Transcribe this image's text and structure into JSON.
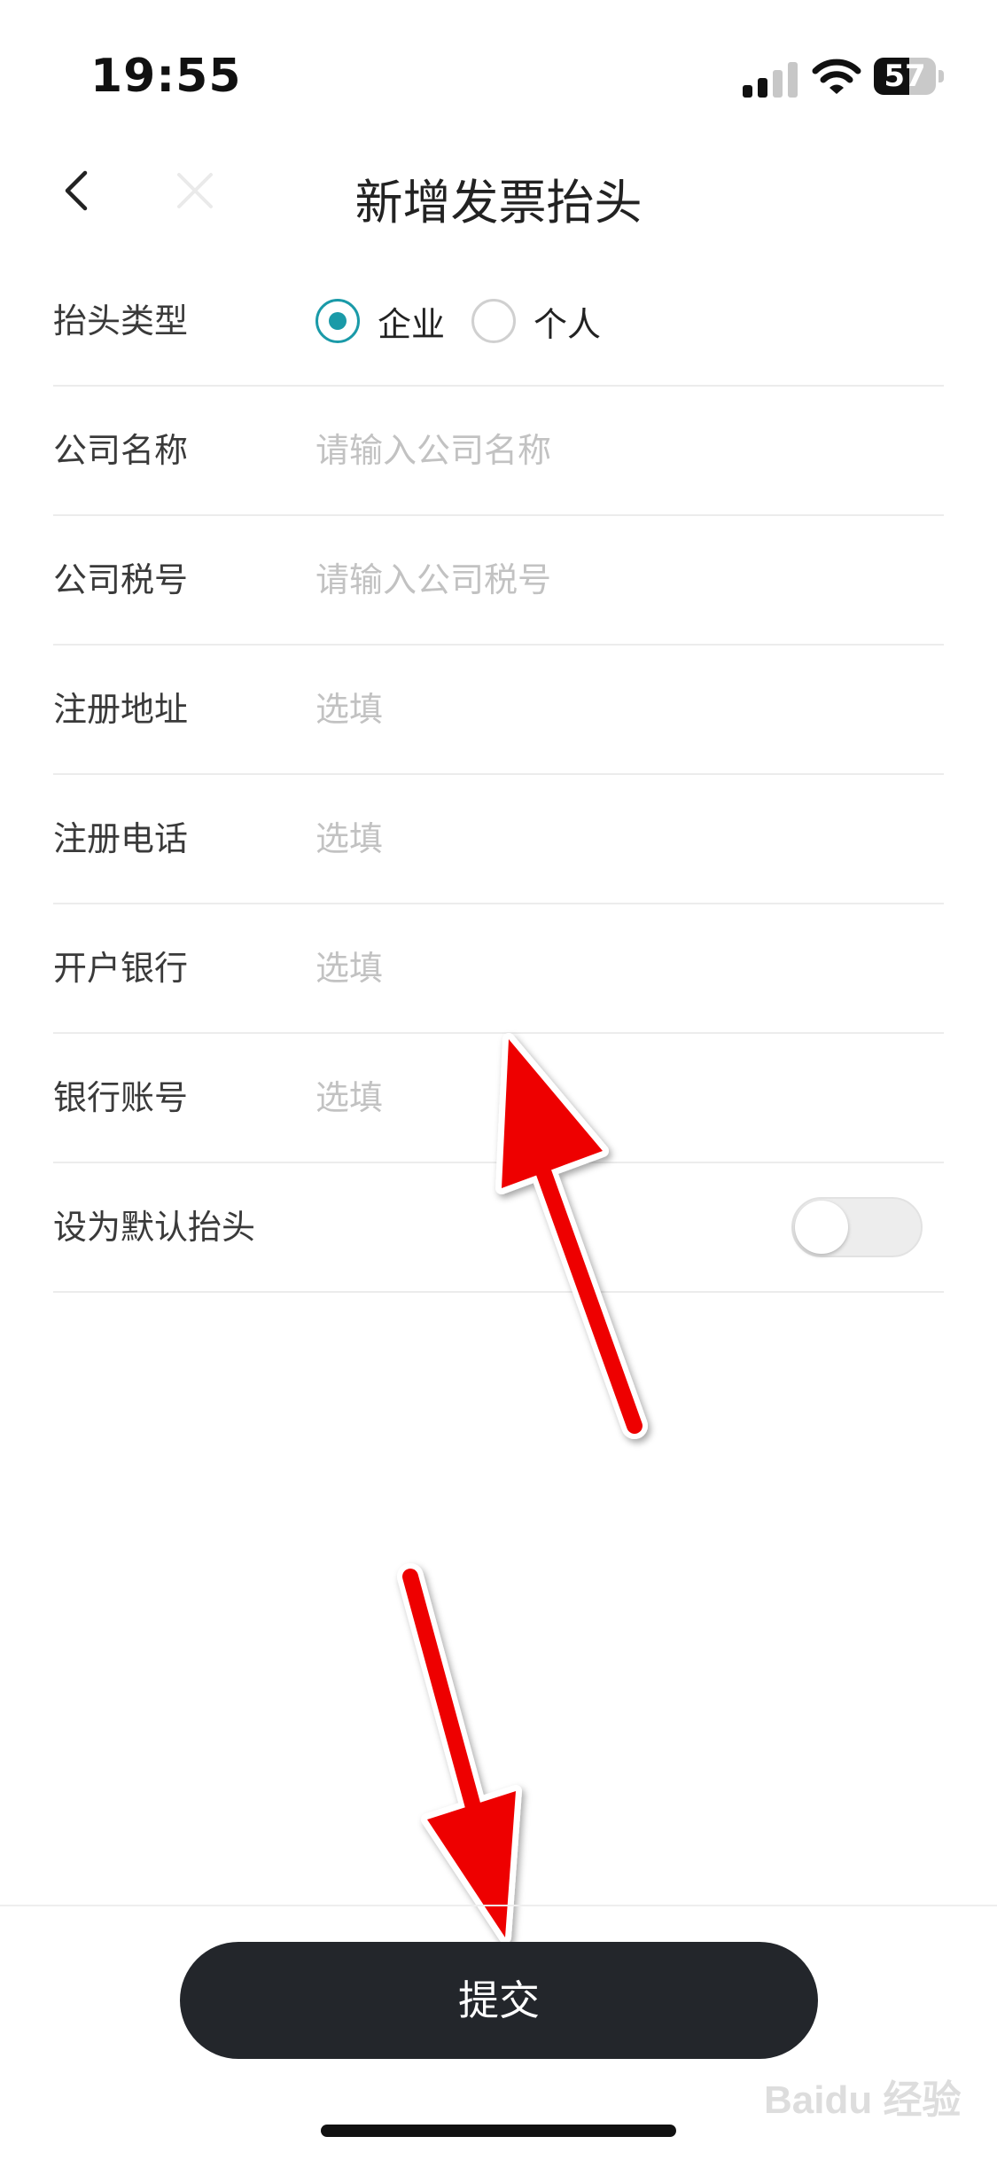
{
  "status_bar": {
    "time": "19:55",
    "battery": "57",
    "battery_level": 0.57
  },
  "nav": {
    "title": "新增发票抬头",
    "back_icon": "chevron-left-icon",
    "close_icon": "close-icon"
  },
  "form": {
    "header_type": {
      "label": "抬头类型",
      "options": [
        "企业",
        "个人"
      ],
      "selected": "企业"
    },
    "fields": [
      {
        "label": "公司名称",
        "placeholder": "请输入公司名称",
        "value": ""
      },
      {
        "label": "公司税号",
        "placeholder": "请输入公司税号",
        "value": ""
      },
      {
        "label": "注册地址",
        "placeholder": "选填",
        "value": ""
      },
      {
        "label": "注册电话",
        "placeholder": "选填",
        "value": ""
      },
      {
        "label": "开户银行",
        "placeholder": "选填",
        "value": ""
      },
      {
        "label": "银行账号",
        "placeholder": "选填",
        "value": ""
      }
    ],
    "default_toggle": {
      "label": "设为默认抬头",
      "on": false
    }
  },
  "submit_label": "提交",
  "colors": {
    "accent": "#1a9aa8",
    "button": "#23262b",
    "arrow": "#ee0000"
  },
  "watermark": "Baidu 经验"
}
